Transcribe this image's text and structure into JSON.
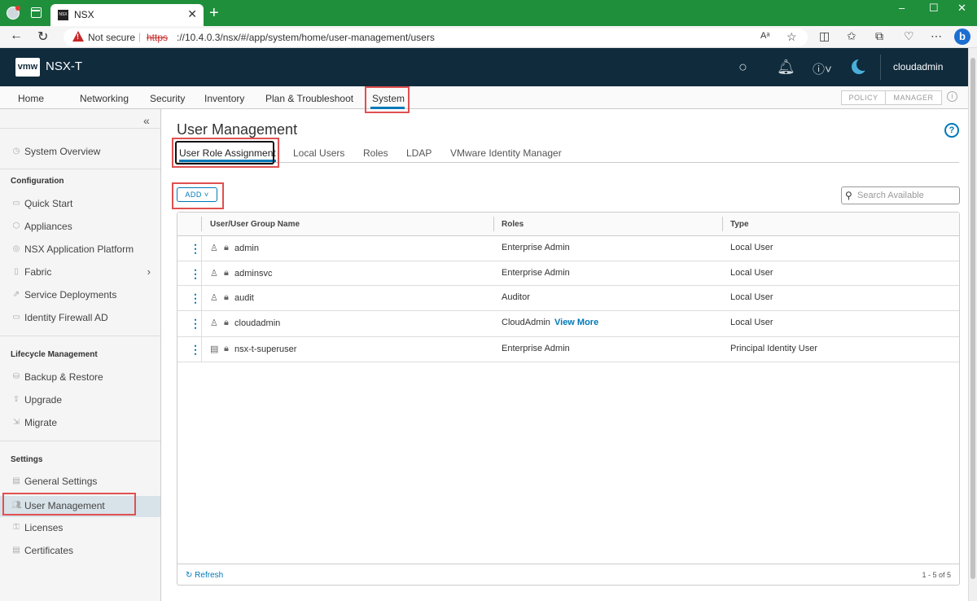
{
  "browser": {
    "tab_title": "NSX",
    "tab_favicon_text": "NSX",
    "not_secure": "Not secure",
    "url_scheme": "https",
    "url_rest": "://10.4.0.3/nsx/#/app/system/home/user-management/users",
    "window_controls": [
      "–",
      "☐",
      "✕"
    ]
  },
  "header": {
    "logo": "vmw",
    "app_title": "NSX-T",
    "user": "cloudadmin"
  },
  "topnav": {
    "items": [
      "Home",
      "Networking",
      "Security",
      "Inventory",
      "Plan & Troubleshoot",
      "System"
    ],
    "active": "System",
    "mode_policy": "POLICY",
    "mode_manager": "MANAGER"
  },
  "sidebar": {
    "system_overview": "System Overview",
    "configuration": {
      "heading": "Configuration",
      "items": [
        "Quick Start",
        "Appliances",
        "NSX Application Platform",
        "Fabric",
        "Service Deployments",
        "Identity Firewall AD"
      ]
    },
    "lifecycle": {
      "heading": "Lifecycle Management",
      "items": [
        "Backup & Restore",
        "Upgrade",
        "Migrate"
      ]
    },
    "settings": {
      "heading": "Settings",
      "items": [
        "General Settings",
        "User Management",
        "Licenses",
        "Certificates"
      ]
    },
    "active": "User Management"
  },
  "main": {
    "title": "User Management",
    "subtabs": [
      "User Role Assignment",
      "Local Users",
      "Roles",
      "LDAP",
      "VMware Identity Manager"
    ],
    "active_subtab": "User Role Assignment",
    "add_label": "ADD",
    "search_placeholder": "Search Available",
    "columns": [
      "User/User Group Name",
      "Roles",
      "Type"
    ],
    "rows": [
      {
        "name": "admin",
        "role": "Enterprise Admin",
        "more": "",
        "type": "Local User",
        "icon": "user-icon"
      },
      {
        "name": "adminsvc",
        "role": "Enterprise Admin",
        "more": "",
        "type": "Local User",
        "icon": "user-icon"
      },
      {
        "name": "audit",
        "role": "Auditor",
        "more": "",
        "type": "Local User",
        "icon": "user-icon"
      },
      {
        "name": "cloudadmin",
        "role": "CloudAdmin",
        "more": "View More",
        "type": "Local User",
        "icon": "user-icon"
      },
      {
        "name": "nsx-t-superuser",
        "role": "Enterprise Admin",
        "more": "",
        "type": "Principal Identity User",
        "icon": "certificate-icon"
      }
    ],
    "refresh": "Refresh",
    "pager": "1 - 5 of 5"
  },
  "colors": {
    "titlebar": "#1f8f3c",
    "appbar": "#0f2b3c",
    "accent": "#0079b8",
    "highlight": "#e05050"
  }
}
